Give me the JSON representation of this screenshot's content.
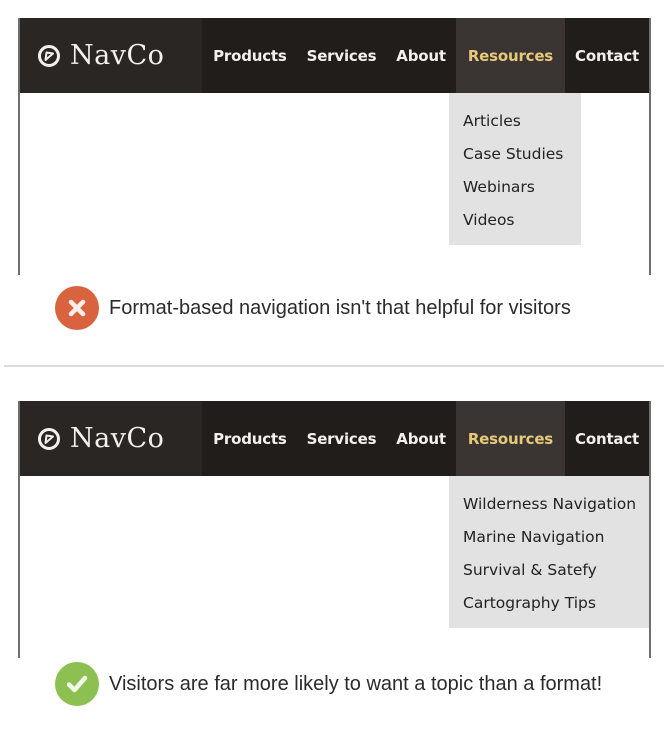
{
  "bad_example": {
    "logo": {
      "icon": "compass-icon",
      "text": "NavCo"
    },
    "nav": [
      {
        "label": "Products"
      },
      {
        "label": "Services"
      },
      {
        "label": "About"
      },
      {
        "label": "Resources",
        "active": true
      },
      {
        "label": "Contact"
      }
    ],
    "dropdown": [
      "Articles",
      "Case Studies",
      "Webinars",
      "Videos"
    ],
    "caption": {
      "icon": "x-circle-icon",
      "text": "Format-based navigation isn't that helpful for visitors",
      "color": "#d9633f"
    }
  },
  "good_example": {
    "logo": {
      "icon": "compass-icon",
      "text": "NavCo"
    },
    "nav": [
      {
        "label": "Products"
      },
      {
        "label": "Services"
      },
      {
        "label": "About"
      },
      {
        "label": "Resources",
        "active": true
      },
      {
        "label": "Contact"
      }
    ],
    "dropdown": [
      "Wilderness Navigation",
      "Marine Navigation",
      "Survival & Satefy",
      "Cartography Tips"
    ],
    "caption": {
      "icon": "check-circle-icon",
      "text": "Visitors are far more likely to want a topic than a format!",
      "color": "#8cc152"
    }
  },
  "colors": {
    "navbar_bg": "#211d1b",
    "active_text": "#e8c97a",
    "dropdown_bg": "#e2e2e2"
  }
}
